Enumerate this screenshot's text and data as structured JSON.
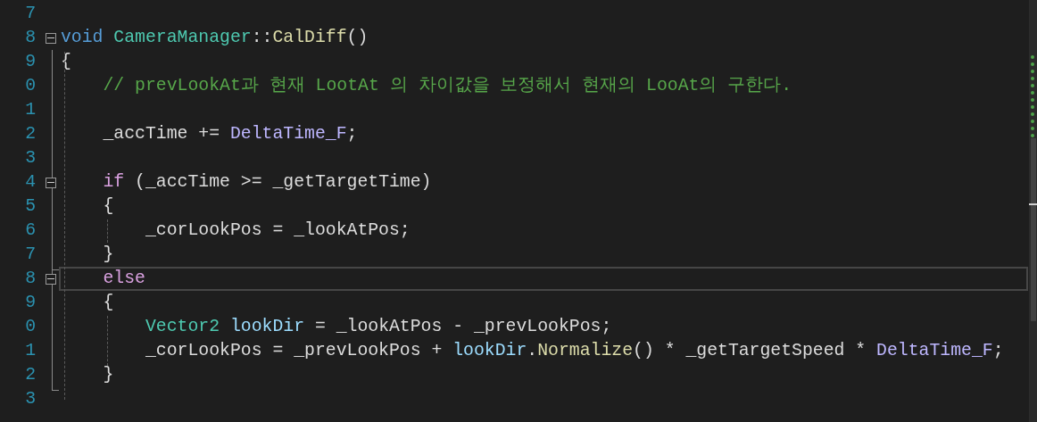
{
  "editor": {
    "lines": [
      {
        "number": "7",
        "selected": false
      },
      {
        "number": "8",
        "selected": false,
        "expanded": true,
        "tokens": [
          {
            "text": "void",
            "kind": "keyword"
          },
          {
            "text": " CameraManager",
            "kind": "type"
          },
          {
            "text": "::",
            "kind": "plain"
          },
          {
            "text": "CalDiff",
            "kind": "function"
          },
          {
            "text": "()",
            "kind": "plain"
          }
        ]
      },
      {
        "number": "9",
        "selected": false,
        "tokens": [
          {
            "text": "{",
            "kind": "plain"
          }
        ]
      },
      {
        "number": "0",
        "selected": false,
        "tokens": [
          {
            "text": "    // prevLookAt과 현재 LootAt 의 차이값을 보정해서 현재의 LooAt의 구한다.",
            "kind": "comment"
          }
        ]
      },
      {
        "number": "1",
        "selected": false
      },
      {
        "number": "2",
        "selected": false,
        "tokens": [
          {
            "text": "    _accTime += ",
            "kind": "plain"
          },
          {
            "text": "DeltaTime_F",
            "kind": "macro"
          },
          {
            "text": ";",
            "kind": "plain"
          }
        ]
      },
      {
        "number": "3",
        "selected": false
      },
      {
        "number": "4",
        "selected": false,
        "expanded": true,
        "tokens": [
          {
            "text": "    if",
            "kind": "control"
          },
          {
            "text": " (_accTime >= _getTargetTime)",
            "kind": "plain"
          }
        ]
      },
      {
        "number": "5",
        "selected": false,
        "tokens": [
          {
            "text": "    {",
            "kind": "plain"
          }
        ]
      },
      {
        "number": "6",
        "selected": false,
        "tokens": [
          {
            "text": "        _corLookPos = _lookAtPos;",
            "kind": "plain"
          }
        ]
      },
      {
        "number": "7",
        "selected": false,
        "tokens": [
          {
            "text": "    }",
            "kind": "plain"
          }
        ]
      },
      {
        "number": "8",
        "selected": true,
        "expanded": true,
        "tokens": [
          {
            "text": "    else",
            "kind": "control"
          }
        ]
      },
      {
        "number": "9",
        "selected": false,
        "tokens": [
          {
            "text": "    {",
            "kind": "plain"
          }
        ]
      },
      {
        "number": "0",
        "selected": false,
        "tokens": [
          {
            "text": "        Vector2",
            "kind": "type"
          },
          {
            "text": " lookDir",
            "kind": "variable"
          },
          {
            "text": " = _lookAtPos - _prevLookPos;",
            "kind": "plain"
          }
        ]
      },
      {
        "number": "1",
        "selected": false,
        "tokens": [
          {
            "text": "        _corLookPos = _prevLookPos + ",
            "kind": "plain"
          },
          {
            "text": "lookDir",
            "kind": "variable"
          },
          {
            "text": ".",
            "kind": "plain"
          },
          {
            "text": "Normalize",
            "kind": "function"
          },
          {
            "text": "() * _getTargetSpeed * ",
            "kind": "plain"
          },
          {
            "text": "DeltaTime_F",
            "kind": "macro"
          },
          {
            "text": ";",
            "kind": "plain"
          }
        ]
      },
      {
        "number": "2",
        "selected": false,
        "tokens": [
          {
            "text": "    }",
            "kind": "plain"
          }
        ]
      },
      {
        "number": "3",
        "selected": false
      }
    ]
  }
}
